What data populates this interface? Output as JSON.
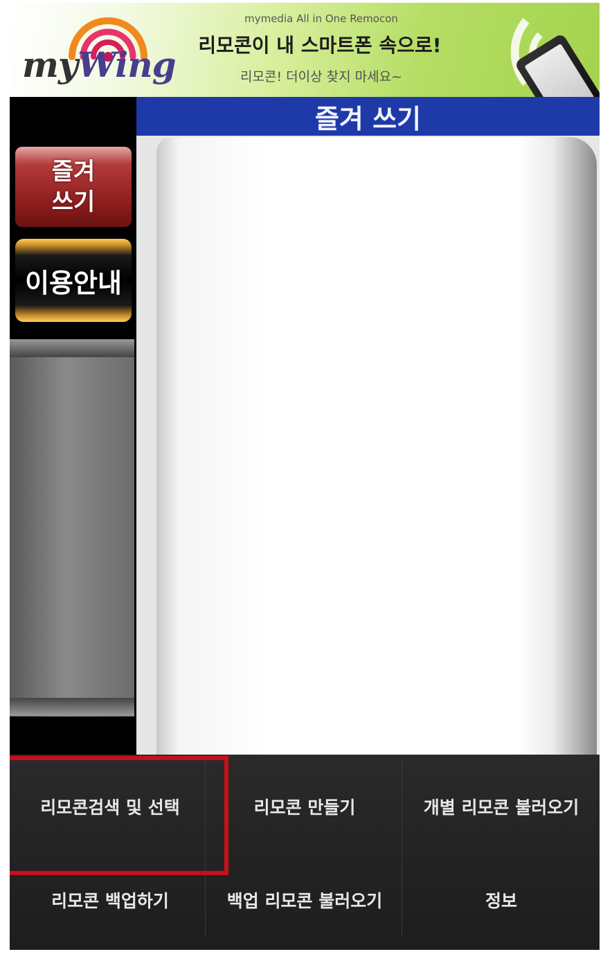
{
  "banner": {
    "logo_text_prefix": "my",
    "logo_text_brand": "Wing",
    "subtitle": "mymedia All in One Remocon",
    "headline": "리모콘이 내 스마트폰 속으로!",
    "tagline": "리모콘! 더이상 찾지 마세요~"
  },
  "sidebar": {
    "favorites_label": "즐겨\n쓰기",
    "guide_label": "이용안내"
  },
  "content": {
    "header_title": "즐겨 쓰기"
  },
  "menu": {
    "items": [
      {
        "label": "리모콘검색 및 선택"
      },
      {
        "label": "리모콘 만들기"
      },
      {
        "label": "개별 리모콘 불러오기"
      },
      {
        "label": "리모콘 백업하기"
      },
      {
        "label": "백업 리모콘 불러오기"
      },
      {
        "label": "정보"
      }
    ]
  },
  "colors": {
    "header_blue": "#1e3aa8",
    "highlight_red": "#c8101a",
    "favorites_red": "#8f1d1d",
    "guide_gold": "#c68a2a"
  }
}
